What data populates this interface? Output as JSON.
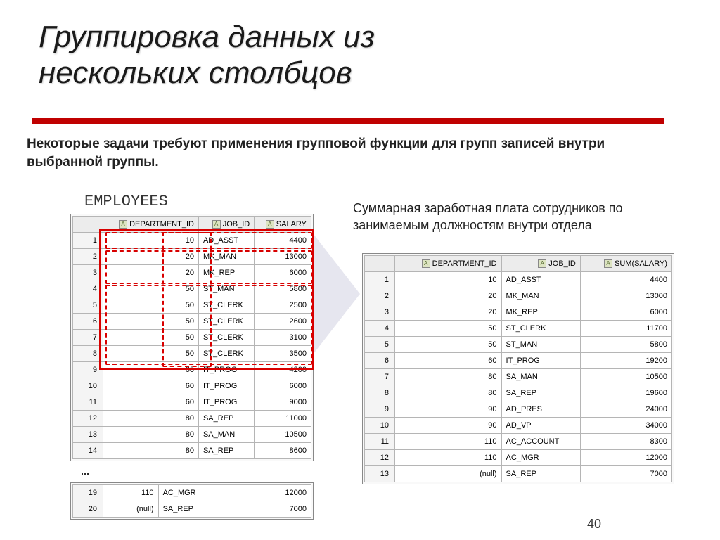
{
  "slide": {
    "title_line1": "Группировка данных из",
    "title_line2": "нескольких столбцов",
    "subtitle": "Некоторые задачи требуют применения групповой функции для групп записей внутри выбранной группы.",
    "table_label": "EMPLOYEES",
    "right_text": "Суммарная заработная плата сотрудников по занимаемым должностям внутри отдела",
    "ellipsis": "…",
    "page_number": "40"
  },
  "left_table": {
    "columns": [
      "DEPARTMENT_ID",
      "JOB_ID",
      "SALARY"
    ],
    "rows": [
      {
        "n": 1,
        "dept": "10",
        "job": "AD_ASST",
        "sal": "4400"
      },
      {
        "n": 2,
        "dept": "20",
        "job": "MK_MAN",
        "sal": "13000"
      },
      {
        "n": 3,
        "dept": "20",
        "job": "MK_REP",
        "sal": "6000"
      },
      {
        "n": 4,
        "dept": "50",
        "job": "ST_MAN",
        "sal": "5800"
      },
      {
        "n": 5,
        "dept": "50",
        "job": "ST_CLERK",
        "sal": "2500"
      },
      {
        "n": 6,
        "dept": "50",
        "job": "ST_CLERK",
        "sal": "2600"
      },
      {
        "n": 7,
        "dept": "50",
        "job": "ST_CLERK",
        "sal": "3100"
      },
      {
        "n": 8,
        "dept": "50",
        "job": "ST_CLERK",
        "sal": "3500"
      },
      {
        "n": 9,
        "dept": "60",
        "job": "IT_PROG",
        "sal": "4200"
      },
      {
        "n": 10,
        "dept": "60",
        "job": "IT_PROG",
        "sal": "6000"
      },
      {
        "n": 11,
        "dept": "60",
        "job": "IT_PROG",
        "sal": "9000"
      },
      {
        "n": 12,
        "dept": "80",
        "job": "SA_REP",
        "sal": "11000"
      },
      {
        "n": 13,
        "dept": "80",
        "job": "SA_MAN",
        "sal": "10500"
      },
      {
        "n": 14,
        "dept": "80",
        "job": "SA_REP",
        "sal": "8600"
      }
    ]
  },
  "left_tail": {
    "rows": [
      {
        "n": 19,
        "dept": "110",
        "job": "AC_MGR",
        "sal": "12000"
      },
      {
        "n": 20,
        "dept": "(null)",
        "job": "SA_REP",
        "sal": "7000"
      }
    ]
  },
  "right_table": {
    "columns": [
      "DEPARTMENT_ID",
      "JOB_ID",
      "SUM(SALARY)"
    ],
    "rows": [
      {
        "n": 1,
        "dept": "10",
        "job": "AD_ASST",
        "sum": "4400"
      },
      {
        "n": 2,
        "dept": "20",
        "job": "MK_MAN",
        "sum": "13000"
      },
      {
        "n": 3,
        "dept": "20",
        "job": "MK_REP",
        "sum": "6000"
      },
      {
        "n": 4,
        "dept": "50",
        "job": "ST_CLERK",
        "sum": "11700"
      },
      {
        "n": 5,
        "dept": "50",
        "job": "ST_MAN",
        "sum": "5800"
      },
      {
        "n": 6,
        "dept": "60",
        "job": "IT_PROG",
        "sum": "19200"
      },
      {
        "n": 7,
        "dept": "80",
        "job": "SA_MAN",
        "sum": "10500"
      },
      {
        "n": 8,
        "dept": "80",
        "job": "SA_REP",
        "sum": "19600"
      },
      {
        "n": 9,
        "dept": "90",
        "job": "AD_PRES",
        "sum": "24000"
      },
      {
        "n": 10,
        "dept": "90",
        "job": "AD_VP",
        "sum": "34000"
      },
      {
        "n": 11,
        "dept": "110",
        "job": "AC_ACCOUNT",
        "sum": "8300"
      },
      {
        "n": 12,
        "dept": "110",
        "job": "AC_MGR",
        "sum": "12000"
      },
      {
        "n": 13,
        "dept": "(null)",
        "job": "SA_REP",
        "sum": "7000"
      }
    ]
  }
}
